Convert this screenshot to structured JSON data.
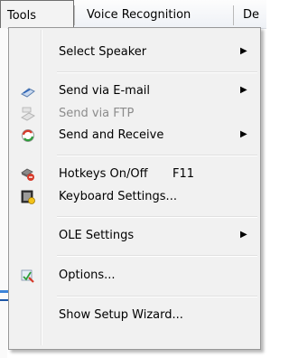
{
  "menubar": {
    "tools": "Tools",
    "voice": "Voice Recognition",
    "cut": "De"
  },
  "menu": {
    "items": [
      {
        "label": "Select Speaker",
        "submenu": true
      },
      {
        "label": "Send via E-mail",
        "submenu": true,
        "icon": "email-icon"
      },
      {
        "label": "Send via FTP",
        "disabled": true,
        "icon": "ftp-icon"
      },
      {
        "label": "Send and Receive",
        "submenu": true,
        "icon": "send-receive-icon"
      },
      {
        "label": "Hotkeys On/Off",
        "shortcut": "F11",
        "icon": "hotkeys-icon"
      },
      {
        "label": "Keyboard Settings...",
        "icon": "keyboard-settings-icon"
      },
      {
        "label": "OLE Settings",
        "submenu": true
      },
      {
        "label": "Options...",
        "icon": "options-icon"
      },
      {
        "label": "Show Setup Wizard..."
      }
    ],
    "arrow": "▶"
  },
  "colors": {
    "menu_bg": "#f1f1f1",
    "accent_blue": "#1f7fd6",
    "accent_red": "#d63a2a",
    "accent_green": "#2f9e3c"
  }
}
